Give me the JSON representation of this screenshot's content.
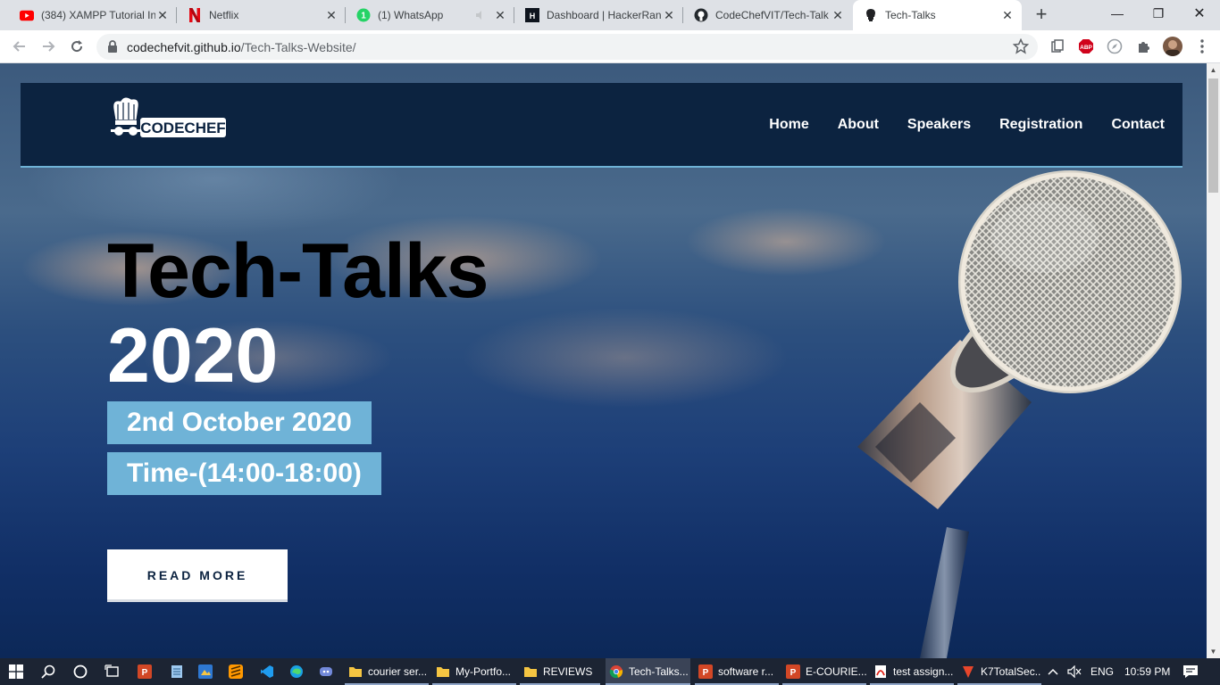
{
  "browser": {
    "tabs": [
      {
        "title": "(384) XAMPP Tutorial In",
        "icon": "youtube-icon"
      },
      {
        "title": "Netflix",
        "icon": "netflix-icon"
      },
      {
        "title": "(1) WhatsApp",
        "icon": "whatsapp-icon"
      },
      {
        "title": "Dashboard | HackerRan",
        "icon": "hackerrank-icon"
      },
      {
        "title": "CodeChefVIT/Tech-Talk",
        "icon": "github-icon"
      },
      {
        "title": "Tech-Talks",
        "icon": "codechef-icon"
      }
    ],
    "close_glyph": "✕",
    "new_tab_glyph": "+",
    "url_host": "codechefvit.github.io",
    "url_path": "/Tech-Talks-Website/",
    "window_controls": {
      "minimize": "—",
      "maximize": "❐",
      "close": "✕"
    },
    "extensions": {
      "abp": "ABP"
    }
  },
  "site": {
    "nav": [
      "Home",
      "About",
      "Speakers",
      "Registration",
      "Contact"
    ],
    "title_line1": "Tech-Talks",
    "title_line2": "2020",
    "date": "2nd October 2020",
    "time": "Time-(14:00-18:00)",
    "read_more": "READ MORE",
    "logo_text": "CODECHEF"
  },
  "taskbar": {
    "apps": [
      {
        "label": "courier ser...",
        "icon": "folder-icon"
      },
      {
        "label": "My-Portfo...",
        "icon": "folder-icon"
      },
      {
        "label": "REVIEWS",
        "icon": "folder-icon"
      },
      {
        "label": "Tech-Talks...",
        "icon": "chrome-icon"
      },
      {
        "label": "software r...",
        "icon": "powerpoint-icon"
      },
      {
        "label": "E-COURIE...",
        "icon": "powerpoint-icon"
      },
      {
        "label": "test assign...",
        "icon": "pdf-icon"
      },
      {
        "label": "K7TotalSec...",
        "icon": "k7-icon"
      }
    ],
    "language": "ENG",
    "clock": "10:59 PM"
  },
  "colors": {
    "nav_bg": "#0c2340",
    "accent": "#6fb3d7",
    "title_dark": "#000000",
    "title_light": "#ffffff"
  }
}
